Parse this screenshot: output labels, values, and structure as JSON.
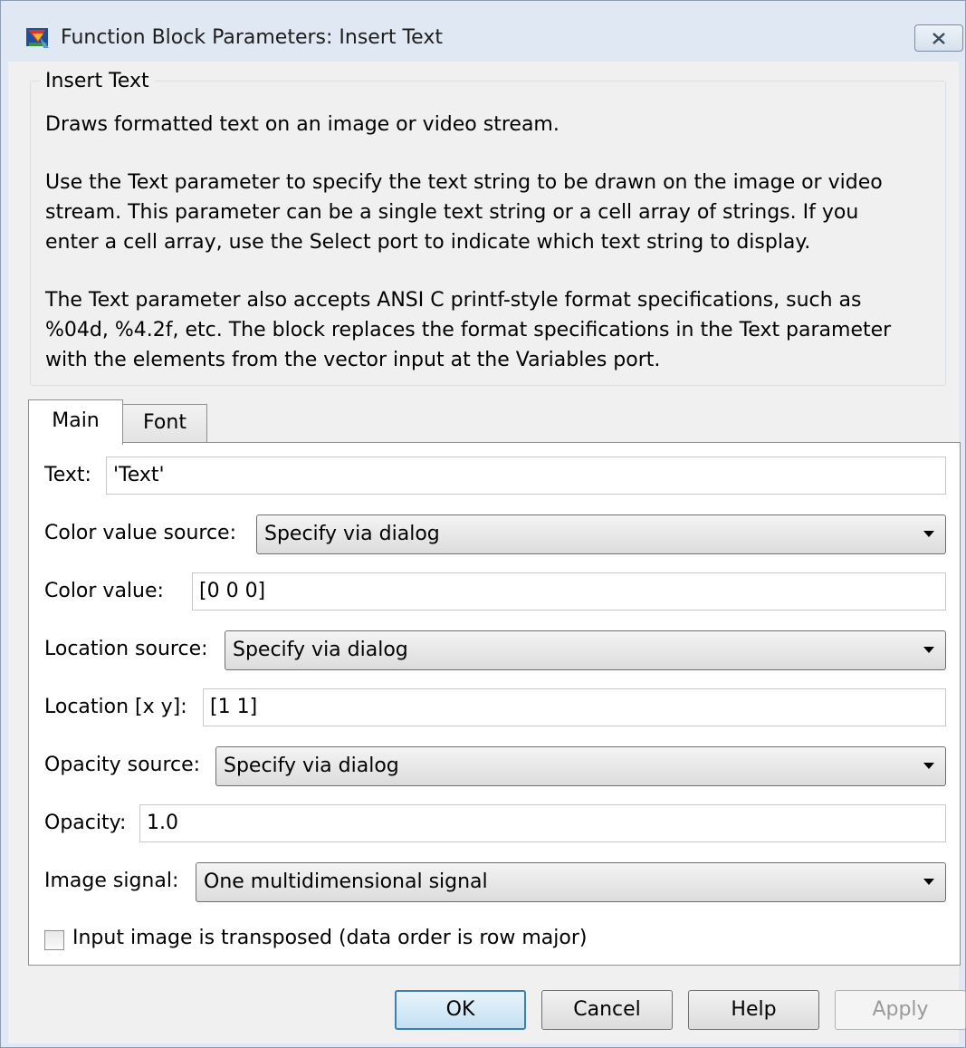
{
  "window": {
    "title": "Function Block Parameters: Insert Text"
  },
  "group": {
    "legend": "Insert Text",
    "description": [
      "Draws formatted text on an image or video stream.",
      "Use the Text parameter to specify the text string to be drawn on the image or video",
      "stream. This parameter can be a single text string or a cell array of strings. If you",
      "enter a cell array, use the Select port to indicate which text string to display.",
      "The Text parameter also accepts ANSI C printf-style format specifications, such as",
      "%04d, %4.2f, etc. The block replaces the format specifications in the Text parameter",
      "with the elements from the vector input at the Variables port."
    ]
  },
  "tabs": [
    {
      "label": "Main",
      "selected": true
    },
    {
      "label": "Font",
      "selected": false
    }
  ],
  "fields": {
    "text": {
      "label": "Text:",
      "value": "'Text'"
    },
    "color_value_source": {
      "label": "Color value source:",
      "value": "Specify via dialog"
    },
    "color_value": {
      "label": "Color value:",
      "value": "[0 0 0]"
    },
    "location_source": {
      "label": "Location source:",
      "value": "Specify via dialog"
    },
    "location": {
      "label": "Location [x y]:",
      "value": "[1 1]"
    },
    "opacity_source": {
      "label": "Opacity source:",
      "value": "Specify via dialog"
    },
    "opacity": {
      "label": "Opacity:",
      "value": "1.0"
    },
    "image_signal": {
      "label": "Image signal:",
      "value": "One multidimensional signal"
    }
  },
  "checkbox": {
    "label": "Input image is transposed (data order is row major)",
    "checked": false
  },
  "buttons": {
    "ok": "OK",
    "cancel": "Cancel",
    "help": "Help",
    "apply": "Apply"
  },
  "icons": {
    "app": "simulink-block-icon",
    "close": "close-icon",
    "dropdown": "chevron-down-icon"
  }
}
